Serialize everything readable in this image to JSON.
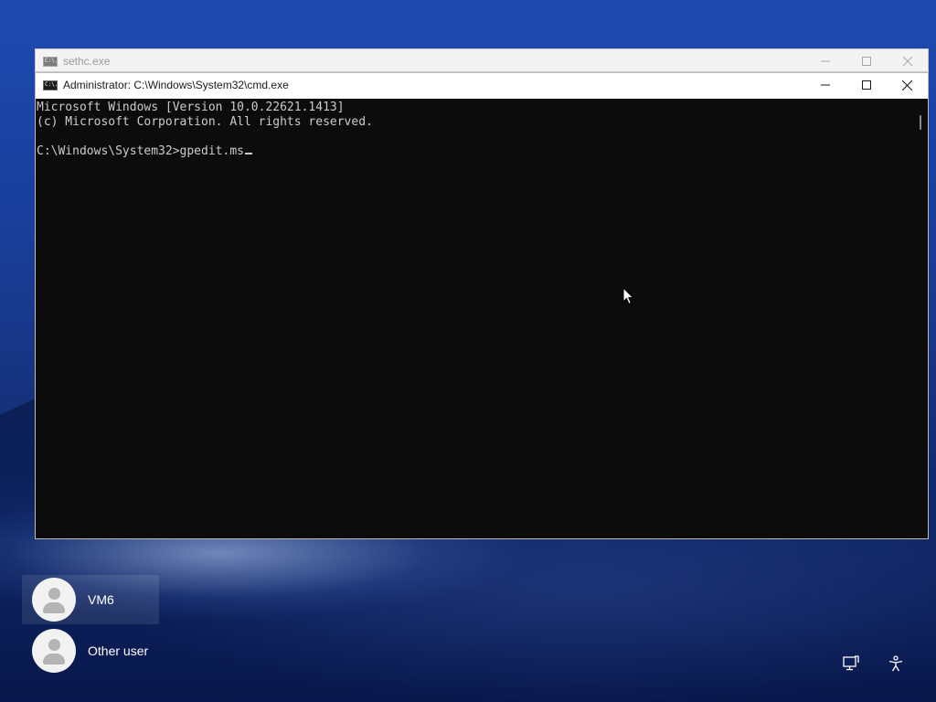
{
  "back_window": {
    "icon_text": "C:\\.",
    "title": "sethc.exe"
  },
  "front_window": {
    "icon_text": "C:\\.",
    "title": "Administrator: C:\\Windows\\System32\\cmd.exe"
  },
  "console": {
    "lines": [
      "Microsoft Windows [Version 10.0.22621.1413]",
      "(c) Microsoft Corporation. All rights reserved.",
      "",
      "C:\\Windows\\System32>gpedit.ms"
    ],
    "colors": {
      "background": "#0c0c0c",
      "text": "#cccccc"
    }
  },
  "users": [
    {
      "name": "VM6",
      "selected": true
    },
    {
      "name": "Other user",
      "selected": false
    }
  ],
  "icons": {
    "network": "network-monitor-icon",
    "accessibility": "accessibility-icon",
    "window_icon": "cmd-icon"
  }
}
